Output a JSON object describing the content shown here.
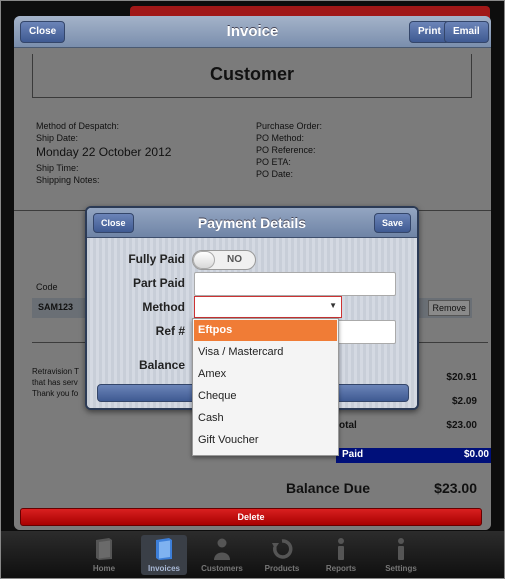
{
  "invoice": {
    "title": "Invoice",
    "close_label": "Close",
    "print_label": "Print",
    "email_label": "Email",
    "customer_title": "Customer",
    "left_meta": {
      "despatch": "Method of Despatch:",
      "ship_date_label": "Ship Date:",
      "ship_date_value": "Monday 22 October 2012",
      "ship_time": "Ship Time:",
      "shipping_notes": "Shipping Notes:"
    },
    "right_meta": {
      "purchase_order": "Purchase Order:",
      "po_method": "PO Method:",
      "po_reference": "PO Reference:",
      "po_eta": "PO ETA:",
      "po_date": "PO Date:"
    },
    "items": {
      "code_header": "Code",
      "rows": [
        {
          "code": "SAM123",
          "remove_label": "Remove"
        }
      ]
    },
    "notes": [
      "Retravision T",
      "that has serv",
      "Thank you fo"
    ],
    "totals": {
      "amount_1": "$20.91",
      "amount_2": "$2.09",
      "total_label_fragment": "otal",
      "total_value": "$23.00",
      "paid_label": "Paid",
      "paid_value": "$0.00",
      "balance_label": "Balance Due",
      "balance_value": "$23.00"
    },
    "delete_label": "Delete"
  },
  "payment_modal": {
    "title": "Payment Details",
    "close_label": "Close",
    "save_label": "Save",
    "fully_paid_label": "Fully Paid",
    "toggle_value": "NO",
    "part_paid_label": "Part Paid",
    "method_label": "Method",
    "ref_label": "Ref #",
    "balance_label": "Balance"
  },
  "method_options": [
    "Eftpos",
    "Visa / Mastercard",
    "Amex",
    "Cheque",
    "Cash",
    "Gift Voucher"
  ],
  "selected_method": "Eftpos",
  "tabbar": {
    "tabs": [
      {
        "label": "Home",
        "icon": "book-icon",
        "active": false
      },
      {
        "label": "Invoices",
        "icon": "book-icon",
        "active": true
      },
      {
        "label": "Customers",
        "icon": "person-icon",
        "active": false
      },
      {
        "label": "Products",
        "icon": "refresh-icon",
        "active": false
      },
      {
        "label": "Reports",
        "icon": "info-icon",
        "active": false
      },
      {
        "label": "Settings",
        "icon": "info-icon",
        "active": false
      }
    ]
  },
  "colors": {
    "header_blue": "#7a8ead",
    "selected_orange": "#f07c36",
    "paid_navy": "#00107a",
    "delete_red": "#c81818"
  }
}
